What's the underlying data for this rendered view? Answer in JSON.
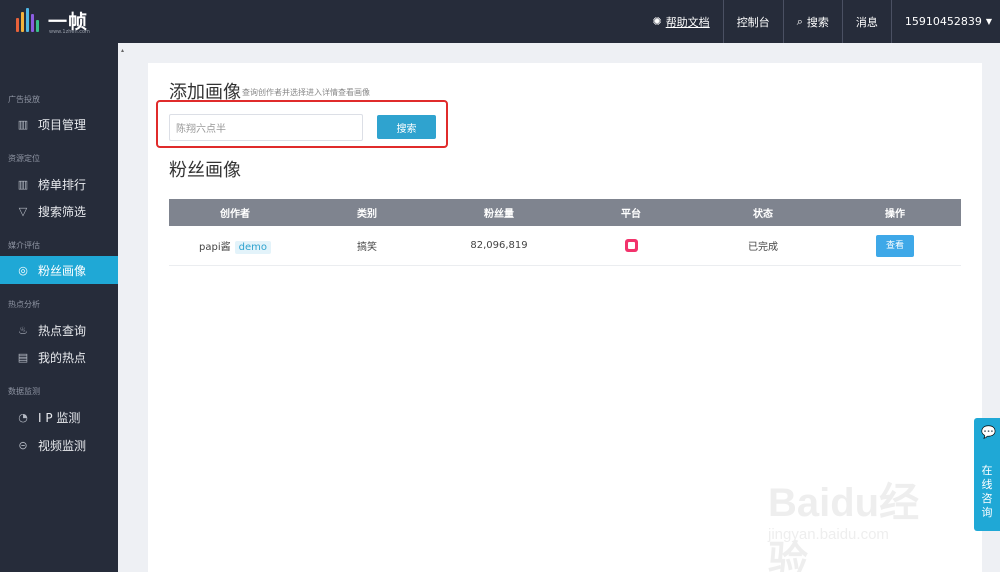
{
  "topbar": {
    "logo_name": "一帧",
    "logo_sub": "www.1zhen.com",
    "help": "帮助文档",
    "console": "控制台",
    "search": "搜索",
    "messages": "消息",
    "user": "15910452839"
  },
  "sidebar": {
    "sections": [
      {
        "title": "广告投放",
        "items": [
          {
            "label": "项目管理",
            "icon": "bar-chart-icon"
          }
        ]
      },
      {
        "title": "资源定位",
        "items": [
          {
            "label": "榜单排行",
            "icon": "bar-chart-icon"
          },
          {
            "label": "搜索筛选",
            "icon": "filter-icon"
          }
        ]
      },
      {
        "title": "媒介评估",
        "items": [
          {
            "label": "粉丝画像",
            "icon": "palette-icon",
            "active": true
          }
        ]
      },
      {
        "title": "热点分析",
        "items": [
          {
            "label": "热点查询",
            "icon": "fire-icon"
          },
          {
            "label": "我的热点",
            "icon": "document-icon"
          }
        ]
      },
      {
        "title": "数据监测",
        "items": [
          {
            "label": "I P 监测",
            "icon": "pie-chart-icon"
          },
          {
            "label": "视频监测",
            "icon": "search-circle-icon"
          }
        ]
      }
    ]
  },
  "main": {
    "title": "添加画像",
    "subtitle": "查询创作者并选择进入详情查看画像",
    "search_placeholder": "陈翔六点半",
    "search_button": "搜索",
    "section_title": "粉丝画像",
    "table": {
      "headers": [
        "创作者",
        "类别",
        "粉丝量",
        "平台",
        "状态",
        "操作"
      ],
      "rows": [
        {
          "creator": "papi酱",
          "badge": "demo",
          "category": "搞笑",
          "fans": "82,096,819",
          "platform": "video-platform-icon",
          "status": "已完成",
          "action": "查看"
        }
      ]
    }
  },
  "chat": {
    "text": "在线咨询"
  },
  "watermark": {
    "main": "Baidu经验",
    "sub": "jingyan.baidu.com"
  },
  "colors": {
    "topbar_bg": "#262c3a",
    "accent": "#1fa8d6",
    "highlight_border": "#e02b2b",
    "table_header": "#7f848f"
  }
}
